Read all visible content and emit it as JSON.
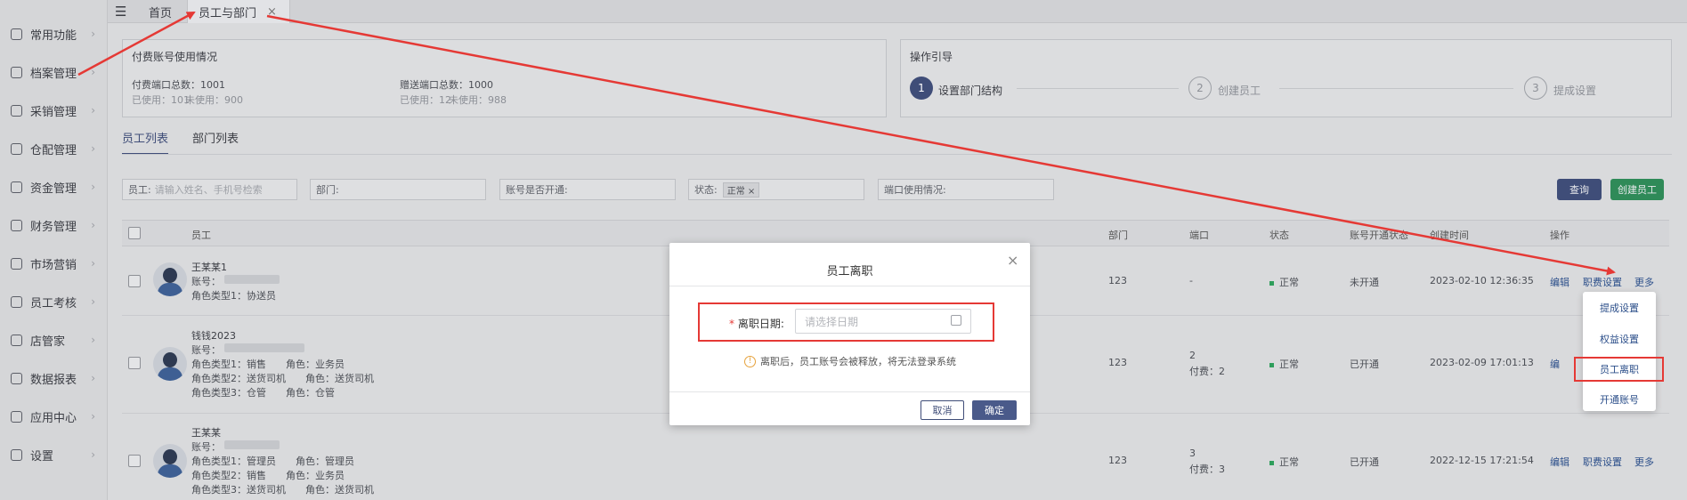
{
  "sidebar": {
    "items": [
      {
        "label": "常用功能",
        "icon": "bookmark-icon"
      },
      {
        "label": "档案管理",
        "icon": "grid-icon"
      },
      {
        "label": "采销管理",
        "icon": "clipboard-icon"
      },
      {
        "label": "仓配管理",
        "icon": "home-icon"
      },
      {
        "label": "资金管理",
        "icon": "coin-icon"
      },
      {
        "label": "财务管理",
        "icon": "calculator-icon"
      },
      {
        "label": "市场营销",
        "icon": "chart-icon"
      },
      {
        "label": "员工考核",
        "icon": "users-icon"
      },
      {
        "label": "店管家",
        "icon": "store-icon"
      },
      {
        "label": "数据报表",
        "icon": "bar-chart-icon"
      },
      {
        "label": "应用中心",
        "icon": "apps-icon"
      },
      {
        "label": "设置",
        "icon": "gear-icon"
      }
    ]
  },
  "tabs": {
    "home": "首页",
    "active": "员工与部门",
    "close": "×"
  },
  "usage": {
    "title": "付费账号使用情况",
    "paid_total": "付费端口总数：1001",
    "paid_used": "已使用：101",
    "paid_unused": "未使用：900",
    "gift_total": "赠送端口总数：1000",
    "gift_used": "已使用：12",
    "gift_unused": "未使用：988"
  },
  "guide": {
    "title": "操作引导",
    "steps": [
      {
        "num": "1",
        "label": "设置部门结构"
      },
      {
        "num": "2",
        "label": "创建员工"
      },
      {
        "num": "3",
        "label": "提成设置"
      }
    ]
  },
  "subtabs": {
    "employees": "员工列表",
    "departments": "部门列表"
  },
  "filters": {
    "employee_label": "员工:",
    "employee_placeholder": "请输入姓名、手机号检索",
    "department_label": "部门:",
    "account_label": "账号是否开通:",
    "status_label": "状态:",
    "status_tag": "正常",
    "port_label": "端口使用情况:",
    "query_button": "查询",
    "create_button": "创建员工"
  },
  "table": {
    "headers": {
      "employee": "员工",
      "department": "部门",
      "port": "端口",
      "status": "状态",
      "account": "账号开通状态",
      "created": "创建时间",
      "ops": "操作"
    },
    "rows": [
      {
        "name": "王某某1",
        "account": "账号：",
        "role_lines": [
          "角色类型1：协送员"
        ],
        "department": "123",
        "port": "-",
        "port_paid": "",
        "status": "正常",
        "account_status": "未开通",
        "created": "2023-02-10 12:36:35",
        "edit": "编辑",
        "settings": "职费设置",
        "more": "更多"
      },
      {
        "name": "钱钱2023",
        "account": "账号：",
        "role_lines": [
          "角色类型1：销售　　角色：业务员",
          "角色类型2：送货司机　　角色：送货司机",
          "角色类型3：仓管　　角色：仓管"
        ],
        "department": "123",
        "port": "2",
        "port_paid": "付费：2",
        "status": "正常",
        "account_status": "已开通",
        "created": "2023-02-09 17:01:13",
        "edit": "编",
        "settings": "",
        "more": ""
      },
      {
        "name": "王某某",
        "account": "账号：",
        "role_lines": [
          "角色类型1：管理员　　角色：管理员",
          "角色类型2：销售　　角色：业务员",
          "角色类型3：送货司机　　角色：送货司机"
        ],
        "department": "123",
        "port": "3",
        "port_paid": "付费：3",
        "status": "正常",
        "account_status": "已开通",
        "created": "2022-12-15 17:21:54",
        "edit": "编辑",
        "settings": "职费设置",
        "more": "更多"
      }
    ]
  },
  "dropdown": {
    "items": [
      "提成设置",
      "权益设置",
      "员工离职",
      "开通账号"
    ]
  },
  "modal": {
    "title": "员工离职",
    "required_mark": "*",
    "date_label": "离职日期:",
    "date_placeholder": "请选择日期",
    "warning": "离职后，员工账号会被释放，将无法登录系统",
    "cancel": "取消",
    "confirm": "确定"
  },
  "colors": {
    "highlight_red": "#e53935",
    "primary": "#4a5a8a",
    "success": "#2f9e5c"
  }
}
